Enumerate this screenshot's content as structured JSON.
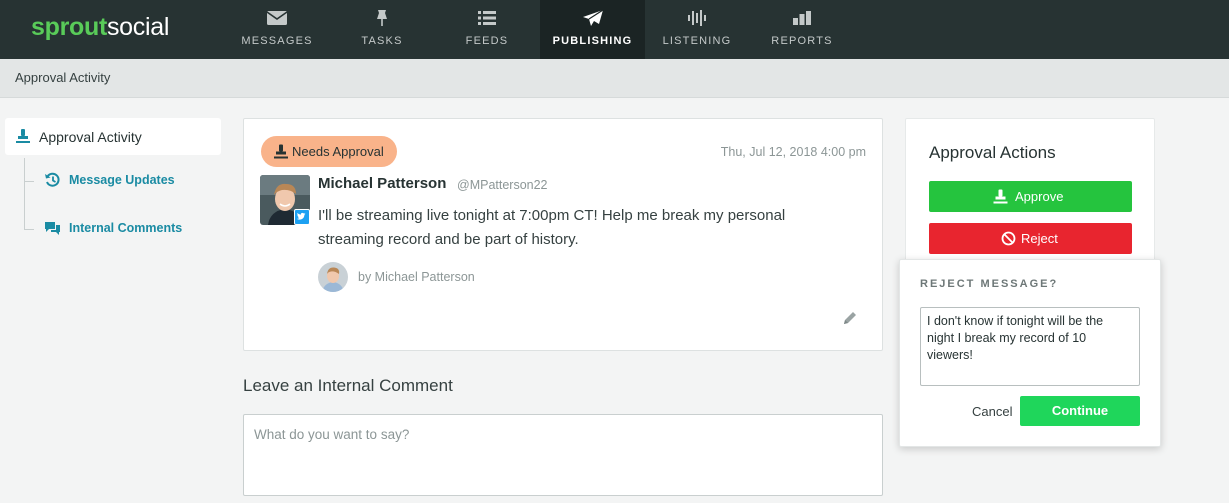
{
  "brand": {
    "part1": "sprout",
    "part2": "social",
    "accent": "#59cb59",
    "nav_bg": "#273333"
  },
  "nav": [
    {
      "label": "MESSAGES",
      "icon": "envelope-icon"
    },
    {
      "label": "TASKS",
      "icon": "pin-icon"
    },
    {
      "label": "FEEDS",
      "icon": "list-icon"
    },
    {
      "label": "PUBLISHING",
      "icon": "paper-plane-icon",
      "active": true
    },
    {
      "label": "LISTENING",
      "icon": "sound-wave-icon"
    },
    {
      "label": "REPORTS",
      "icon": "bar-chart-icon"
    }
  ],
  "subheader": {
    "title": "Approval Activity"
  },
  "sidebar": {
    "active": {
      "label": "Approval Activity",
      "icon": "stamp-icon"
    },
    "items": [
      {
        "label": "Message Updates",
        "icon": "history-icon"
      },
      {
        "label": "Internal Comments",
        "icon": "chat-bubbles-icon"
      }
    ]
  },
  "message": {
    "status": "Needs Approval",
    "timestamp": "Thu, Jul 12, 2018 4:00 pm",
    "author": "Michael Patterson",
    "handle": "@MPatterson22",
    "network": "twitter",
    "text": "I'll be streaming live tonight at 7:00pm CT! Help me break my personal streaming record and be part of history.",
    "by": "by Michael Patterson",
    "status_color": "#f9b38a"
  },
  "comment": {
    "title": "Leave an Internal Comment",
    "placeholder": "What do you want to say?"
  },
  "approval": {
    "title": "Approval Actions",
    "approve_label": "Approve",
    "reject_label": "Reject",
    "approve_color": "#25c43e",
    "reject_color": "#e8252f"
  },
  "reject_popover": {
    "title": "REJECT MESSAGE?",
    "text": "I don't know if tonight will be the night I break my record of 10 viewers!",
    "cancel_label": "Cancel",
    "continue_label": "Continue"
  }
}
